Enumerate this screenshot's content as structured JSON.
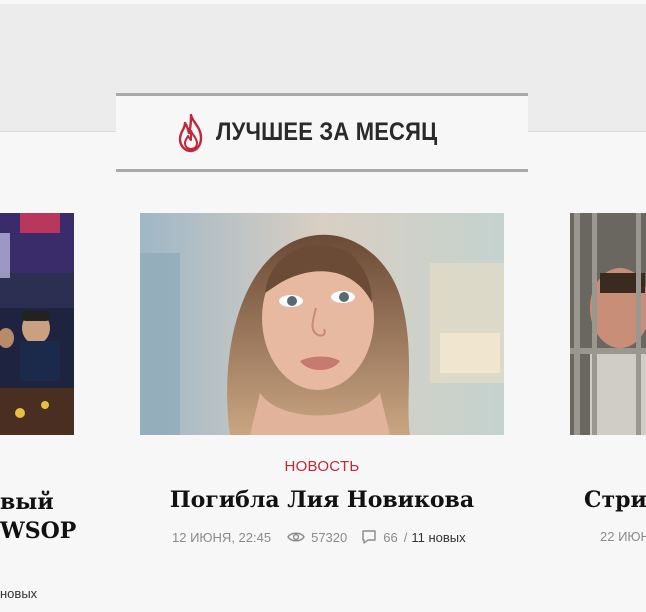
{
  "section": {
    "title": "ЛУЧШЕЕ ЗА МЕСЯЦ",
    "icon": "flame-icon",
    "accent_color": "#c0283a"
  },
  "cards": {
    "left": {
      "title_line1": "вый",
      "title_line2": "WSOP",
      "meta_partial": "новых"
    },
    "center": {
      "category": "НОВОСТЬ",
      "title": "Погибла Лия Новикова",
      "date": "12 ИЮНЯ, 22:45",
      "views": "57320",
      "comments": "66",
      "separator": "/",
      "new_comments": "11 новых"
    },
    "right": {
      "title": "Стри",
      "date": "22 ИЮН"
    }
  }
}
